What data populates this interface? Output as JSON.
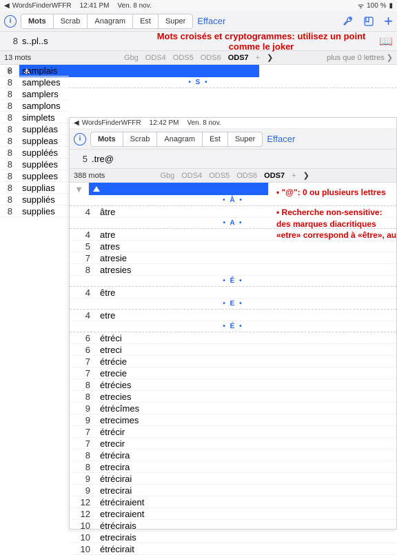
{
  "status": {
    "back": "WordsFinderWFFR",
    "time": "12:41 PM",
    "date": "Ven. 8 nov.",
    "wifi": "100 %"
  },
  "toolbar": {
    "segments": [
      "Mots",
      "Scrab",
      "Anagram",
      "Est",
      "Super"
    ],
    "active": 0,
    "clear": "Effacer"
  },
  "search1": {
    "len": "8",
    "query": "s..pl..s"
  },
  "headline": "Mots croisés et cryptogrammes: utilisez un point comme le joker",
  "sub1": {
    "count": "13 mots",
    "dicts": [
      "Gbg",
      "ODS4",
      "ODS5",
      "ODS6",
      "ODS7",
      "+"
    ],
    "curIdx": 4,
    "more": "plus que 0 lettres  ❯"
  },
  "section1": "• S •",
  "list1": [
    {
      "n": "8",
      "w": "samplais"
    },
    {
      "n": "8",
      "w": "samplees"
    },
    {
      "n": "8",
      "w": "samplers"
    },
    {
      "n": "8",
      "w": "samplons"
    },
    {
      "n": "8",
      "w": "simplets"
    },
    {
      "n": "8",
      "w": "suppléas"
    },
    {
      "n": "8",
      "w": "suppleas"
    },
    {
      "n": "8",
      "w": "suppléés"
    },
    {
      "n": "8",
      "w": "supplées"
    },
    {
      "n": "8",
      "w": "supplees"
    },
    {
      "n": "8",
      "w": "supplias"
    },
    {
      "n": "8",
      "w": "suppliés"
    },
    {
      "n": "8",
      "w": "supplies"
    }
  ],
  "status2": {
    "back": "WordsFinderWFFR",
    "time": "12:42 PM",
    "date": "Ven. 8 nov."
  },
  "search2": {
    "len": "5",
    "query": ".tre@"
  },
  "sub2": {
    "count": "388 mots",
    "dicts": [
      "Gbg",
      "ODS4",
      "ODS5",
      "ODS6",
      "ODS7",
      "+"
    ],
    "curIdx": 4
  },
  "groups2": [
    {
      "h": "• Â •",
      "rows": [
        {
          "n": "4",
          "w": "âtre"
        }
      ]
    },
    {
      "h": "• A •",
      "rows": [
        {
          "n": "4",
          "w": "atre"
        },
        {
          "n": "5",
          "w": "atres"
        },
        {
          "n": "7",
          "w": "atresie"
        },
        {
          "n": "8",
          "w": "atresies"
        }
      ]
    },
    {
      "h": "• Ê •",
      "rows": [
        {
          "n": "4",
          "w": "être"
        }
      ]
    },
    {
      "h": "• E •",
      "rows": [
        {
          "n": "4",
          "w": "etre"
        }
      ]
    },
    {
      "h": "• É •",
      "rows": [
        {
          "n": "6",
          "w": "étréci"
        },
        {
          "n": "6",
          "w": "etreci"
        },
        {
          "n": "7",
          "w": "étrécie"
        },
        {
          "n": "7",
          "w": "etrecie"
        },
        {
          "n": "8",
          "w": "étrécies"
        },
        {
          "n": "8",
          "w": "etrecies"
        },
        {
          "n": "9",
          "w": "étrécîmes"
        },
        {
          "n": "9",
          "w": "etrecimes"
        },
        {
          "n": "7",
          "w": "étrécir"
        },
        {
          "n": "7",
          "w": "etrecir"
        },
        {
          "n": "8",
          "w": "étrécira"
        },
        {
          "n": "8",
          "w": "etrecira"
        },
        {
          "n": "9",
          "w": "étrécirai"
        },
        {
          "n": "9",
          "w": "etrecirai"
        },
        {
          "n": "12",
          "w": "étréciraient"
        },
        {
          "n": "12",
          "w": "etreciraient"
        },
        {
          "n": "10",
          "w": "étrécirais"
        },
        {
          "n": "10",
          "w": "etrecirais"
        },
        {
          "n": "10",
          "w": "étrécirait"
        }
      ]
    }
  ],
  "note1": "• \"@\": 0 ou plusieurs lettres",
  "note2a": "• Recherche non-sensitive:",
  "note2b": "des marques diacritiques",
  "note2c": "«etre» correspond à «être», aussi"
}
